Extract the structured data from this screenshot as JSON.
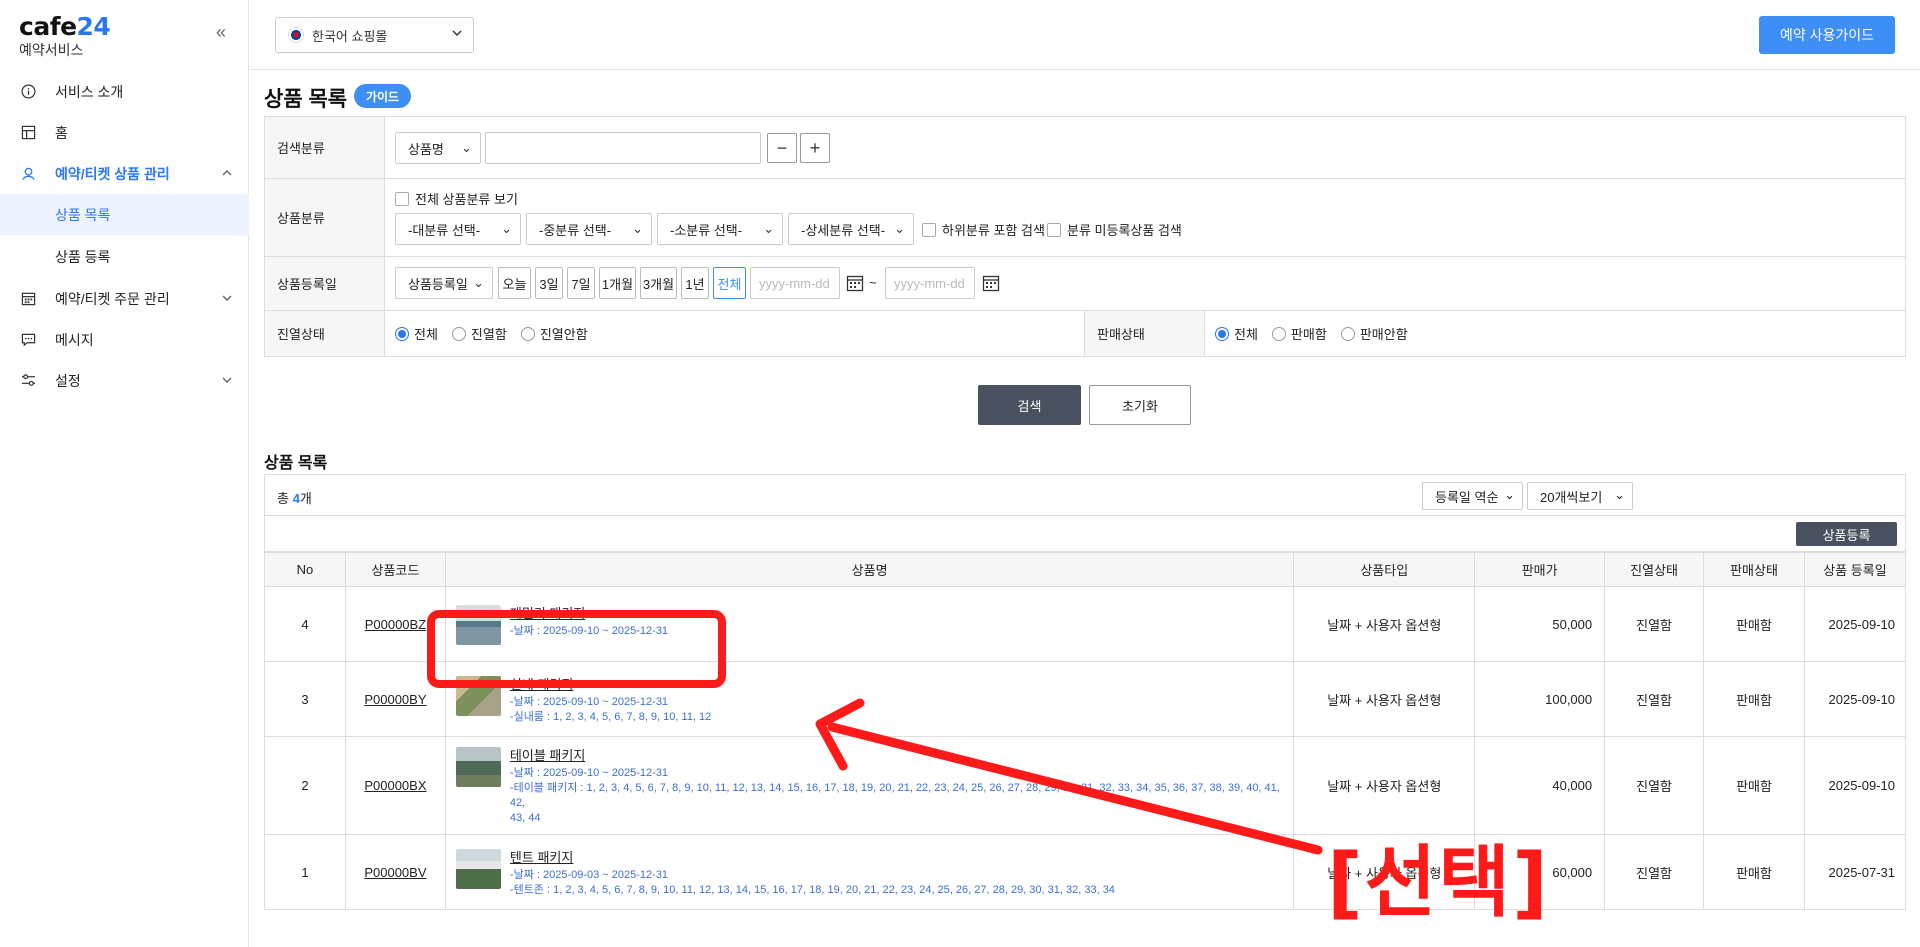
{
  "sidebar": {
    "logo_main": "cafe",
    "logo_num": "24",
    "logo_sub": "예약서비스",
    "collapse_icon": "«",
    "items": [
      {
        "label": "서비스 소개",
        "icon": "info-icon"
      },
      {
        "label": "홈",
        "icon": "layout-icon"
      },
      {
        "label": "예약/티켓 상품 관리",
        "icon": "location-icon",
        "active": true
      },
      {
        "label": "상품 목록"
      },
      {
        "label": "상품 등록"
      },
      {
        "label": "예약/티켓 주문 관리",
        "icon": "calendar-icon"
      },
      {
        "label": "메시지",
        "icon": "message-icon"
      },
      {
        "label": "설정",
        "icon": "sliders-icon"
      }
    ]
  },
  "topbar": {
    "lang": "한국어 쇼핑몰",
    "guide_button": "예약 사용가이드"
  },
  "page": {
    "title": "상품 목록",
    "guide_badge": "가이드"
  },
  "search": {
    "row1_label": "검색분류",
    "row1_select": "상품명",
    "row2_label": "상품분류",
    "row2_all": "전체 상품분류 보기",
    "cat_large": "-대분류 선택-",
    "cat_mid": "-중분류 선택-",
    "cat_small": "-소분류 선택-",
    "cat_detail": "-상세분류 선택-",
    "include_sub": "하위분류 포함 검색",
    "unregistered": "분류 미등록상품 검색",
    "row3_label": "상품등록일",
    "row3_select": "상품등록일",
    "periods": [
      "오늘",
      "3일",
      "7일",
      "1개월",
      "3개월",
      "1년",
      "전체"
    ],
    "date_placeholder": "yyyy-mm-dd",
    "tilde": "~",
    "row4_label": "진열상태",
    "display_opts": [
      "전체",
      "진열함",
      "진열안함"
    ],
    "row4b_label": "판매상태",
    "sale_opts": [
      "전체",
      "판매함",
      "판매안함"
    ],
    "search_btn": "검색",
    "reset_btn": "초기화"
  },
  "list": {
    "title": "상품 목록",
    "total_prefix": "총 ",
    "total_count": "4",
    "total_suffix": "개",
    "sort": "등록일 역순",
    "per_page": "20개씩보기",
    "register_btn": "상품등록",
    "columns": [
      "No",
      "상품코드",
      "상품명",
      "상품타입",
      "판매가",
      "진열상태",
      "판매상태",
      "상품 등록일"
    ],
    "rows": [
      {
        "no": "4",
        "code": "P00000BZ",
        "name": "패밀리 패키지",
        "l1": "-날짜 : 2025-09-10 ~ 2025-12-31",
        "l2": "",
        "type": "날짜 + 사용자 옵션형",
        "price": "50,000",
        "display": "진열함",
        "sale": "판매함",
        "date": "2025-09-10"
      },
      {
        "no": "3",
        "code": "P00000BY",
        "name": "실내 패키지",
        "l1": "-날짜 : 2025-09-10 ~ 2025-12-31",
        "l2": "-실내룸 : 1, 2, 3, 4, 5, 6, 7, 8, 9, 10, 11, 12",
        "type": "날짜 + 사용자 옵션형",
        "price": "100,000",
        "display": "진열함",
        "sale": "판매함",
        "date": "2025-09-10"
      },
      {
        "no": "2",
        "code": "P00000BX",
        "name": "테이블 패키지",
        "l1": "-날짜 : 2025-09-10 ~ 2025-12-31",
        "l2": "-테이블 패키지 : 1, 2, 3, 4, 5, 6, 7, 8, 9, 10, 11, 12, 13, 14, 15, 16, 17, 18, 19, 20, 21, 22, 23, 24, 25, 26, 27, 28, 29, 30, 31, 32, 33, 34, 35, 36, 37, 38, 39, 40, 41, 42,",
        "l3": "43, 44",
        "type": "날짜 + 사용자 옵션형",
        "price": "40,000",
        "display": "진열함",
        "sale": "판매함",
        "date": "2025-09-10"
      },
      {
        "no": "1",
        "code": "P00000BV",
        "name": "텐트 패키지",
        "l1": "-날짜 : 2025-09-03 ~ 2025-12-31",
        "l2": "-텐트존 : 1, 2, 3, 4, 5, 6, 7, 8, 9, 10, 11, 12, 13, 14, 15, 16, 17, 18, 19, 20, 21, 22, 23, 24, 25, 26, 27, 28, 29, 30, 31, 32, 33, 34",
        "type": "날짜 + 사용자 옵션형",
        "price": "60,000",
        "display": "진열함",
        "sale": "판매함",
        "date": "2025-07-31"
      }
    ]
  },
  "annotation": {
    "text": "[선택]",
    "color": "#ff1a1a"
  }
}
